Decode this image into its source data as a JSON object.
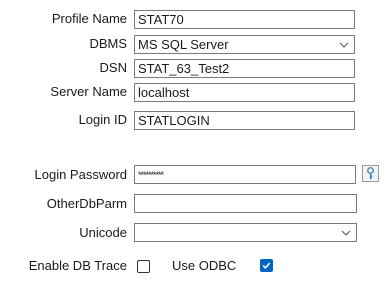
{
  "form": {
    "profile_name": {
      "label": "Profile Name",
      "value": "STAT70"
    },
    "dbms": {
      "label": "DBMS",
      "value": "MS SQL Server"
    },
    "dsn": {
      "label": "DSN",
      "value": "STAT_63_Test2"
    },
    "server_name": {
      "label": "Server Name",
      "value": "localhost"
    },
    "login_id": {
      "label": "Login ID",
      "value": "STATLOGIN"
    },
    "login_password": {
      "label": "Login Password",
      "masked_value": "**********"
    },
    "other_db_parm": {
      "label": "OtherDbParm",
      "value": ""
    },
    "unicode": {
      "label": "Unicode",
      "value": ""
    },
    "enable_db_trace": {
      "label": "Enable DB Trace",
      "checked": false
    },
    "use_odbc": {
      "label": "Use ODBC",
      "checked": true
    }
  },
  "icons": {
    "combo_arrow": "chevron-down-icon",
    "password_key": "key-icon",
    "checkmark": "checkmark-icon"
  },
  "colors": {
    "checkbox_checked": "#0067c0",
    "field_border": "#7a7a7a",
    "key_icon": "#2b7db8"
  }
}
